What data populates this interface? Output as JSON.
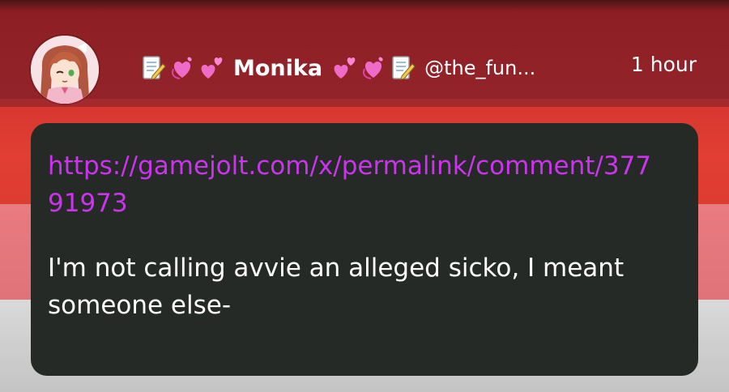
{
  "post": {
    "display_name": "Monika",
    "username": "@the_fun...",
    "timestamp": "1 hour",
    "avatar_icon": "anime-girl-avatar-icon",
    "name_emoji_left": [
      "memo-icon",
      "revolving-hearts-icon",
      "two-hearts-icon"
    ],
    "name_emoji_right": [
      "two-hearts-icon",
      "revolving-hearts-icon",
      "memo-icon"
    ]
  },
  "comment": {
    "link": "https://gamejolt.com/x/permalink/comment/37791973",
    "text": "I'm not calling avvie an alleged sicko, I meant someone else-"
  },
  "colors": {
    "bubble_bg": "#262a27",
    "link": "#cc33ee",
    "text": "#ffffff"
  }
}
